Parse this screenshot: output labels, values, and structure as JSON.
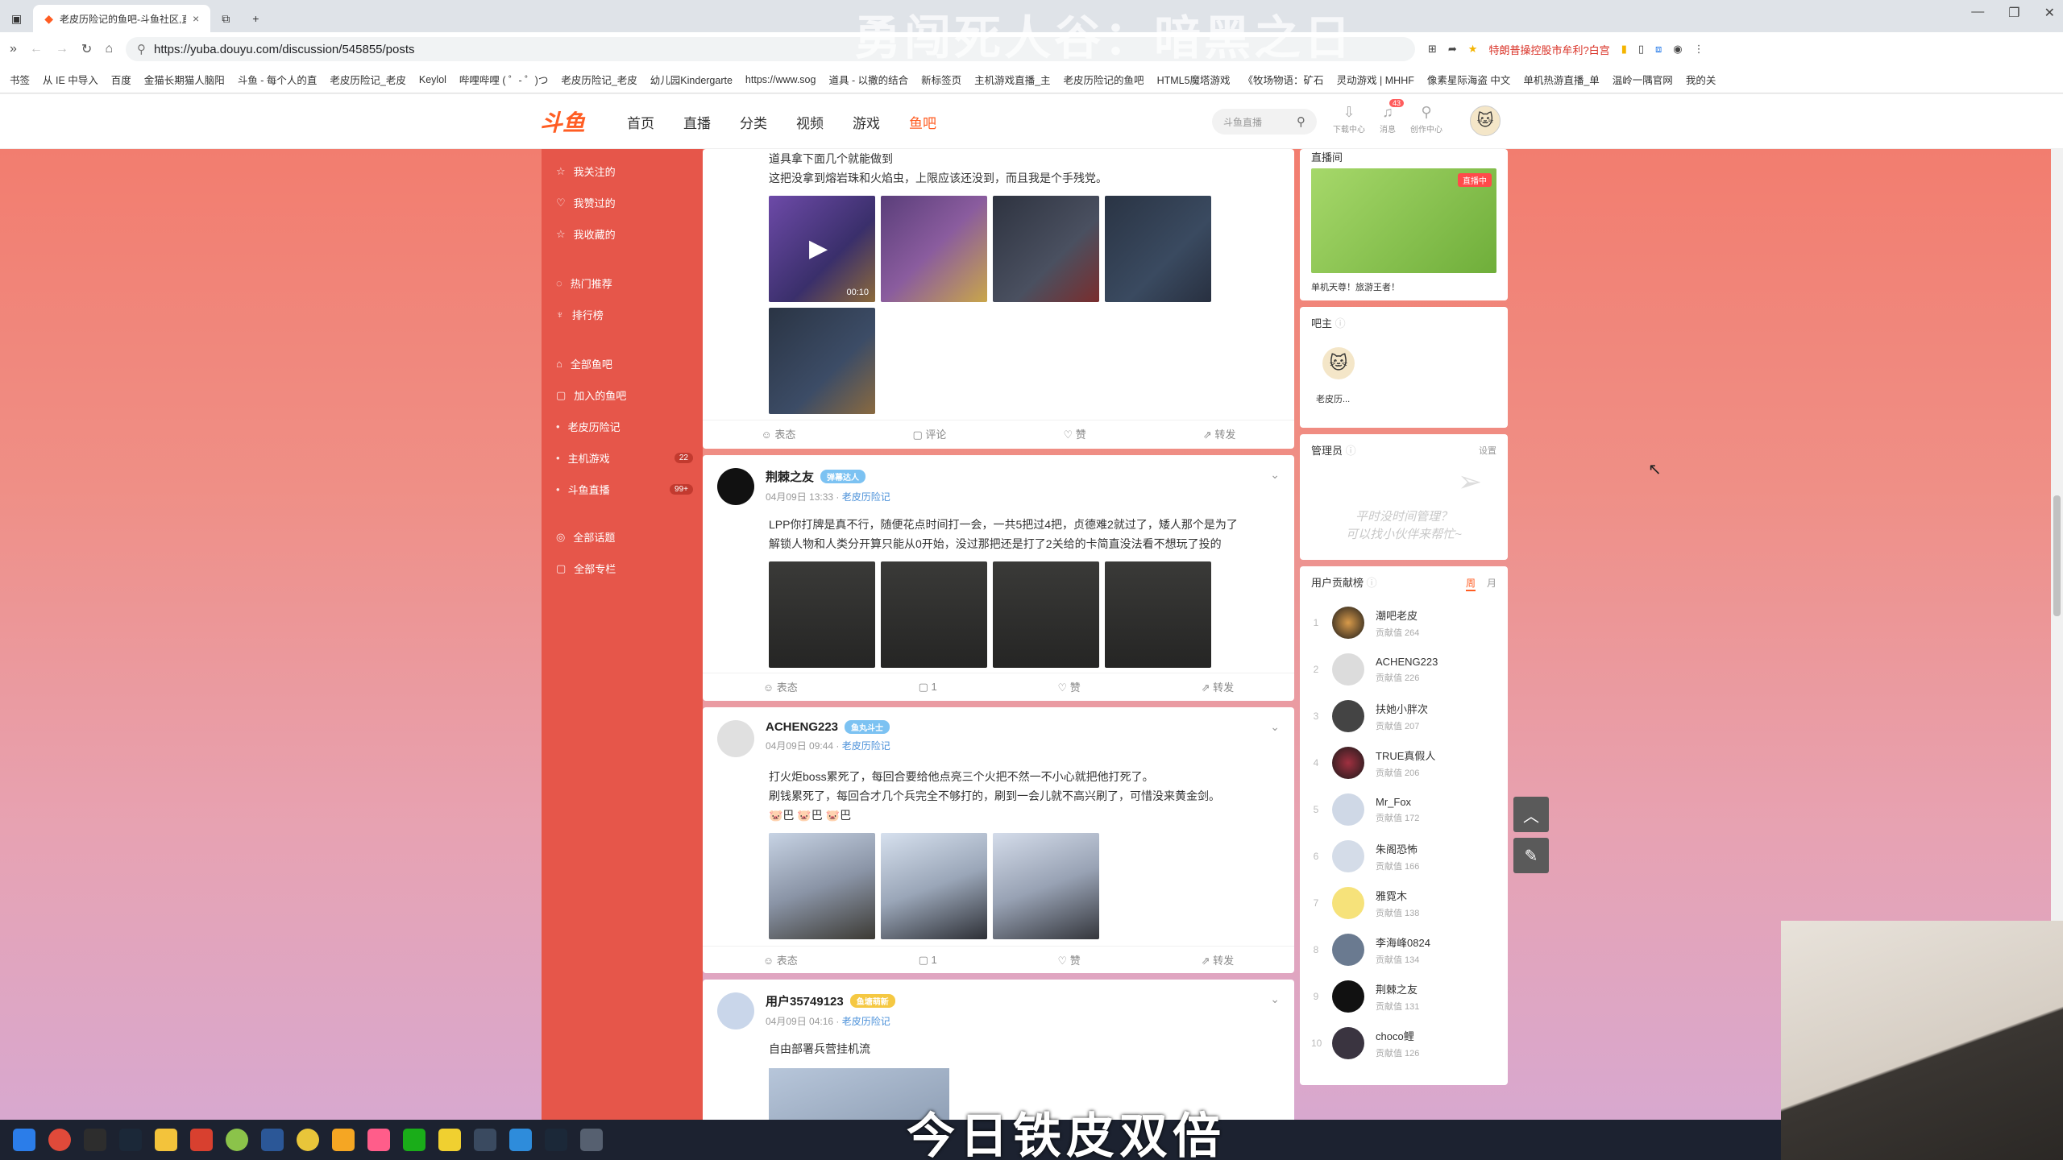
{
  "browser": {
    "tab_title": "老皮历险记的鱼吧-斗鱼社区,直到...",
    "tab_close": "×",
    "new_tab": "+",
    "url": "https://yuba.douyu.com/discussion/545855/posts",
    "address_right": "特朗普操控股市牟利?白宫",
    "bookmarks": [
      "书签",
      "从 IE 中导入",
      "百度",
      "金猫长期猫人脑阳",
      "斗鱼 - 每个人的直",
      "老皮历险记_老皮",
      "Keylol",
      "哔哩哔哩 ( ゜- ゜)つ",
      "老皮历险记_老皮",
      "幼儿园Kindergarte",
      "https://www.sog",
      "道具 - 以撒的结合",
      "新标签页",
      "主机游戏直播_主",
      "老皮历险记的鱼吧",
      "HTML5魔塔游戏",
      "《牧场物语：矿石",
      "灵动游戏 | MHHF",
      "像素星际海盗 中文",
      "单机热游直播_单",
      "温岭一隅官网",
      "我的关"
    ]
  },
  "overlay_title": "勇闯死人谷：暗黑之日",
  "site": {
    "logo": "斗鱼",
    "nav": [
      "首页",
      "直播",
      "分类",
      "视频",
      "游戏",
      "鱼吧"
    ],
    "search_placeholder": "斗鱼直播",
    "header_icons": [
      "下载中心",
      "消息",
      "创作中心"
    ],
    "message_count": "43"
  },
  "sidebar": {
    "items": [
      {
        "label": "我关注的",
        "icon": "star-icon"
      },
      {
        "label": "我赞过的",
        "icon": "thumb-icon"
      },
      {
        "label": "我收藏的",
        "icon": "star-icon"
      },
      {
        "label": "热门推荐",
        "icon": "fire-icon"
      },
      {
        "label": "排行榜",
        "icon": "trophy-icon"
      },
      {
        "label": "全部鱼吧",
        "icon": "home-icon"
      },
      {
        "label": "加入的鱼吧",
        "icon": "doc-icon"
      },
      {
        "label": "老皮历险记",
        "icon": "dot-icon",
        "badge": ""
      },
      {
        "label": "主机游戏",
        "icon": "dot-icon",
        "badge": "22"
      },
      {
        "label": "斗鱼直播",
        "icon": "dot-icon",
        "badge": "99+"
      },
      {
        "label": "全部话题",
        "icon": "circle-icon"
      },
      {
        "label": "全部专栏",
        "icon": "doc-icon"
      }
    ]
  },
  "posts": [
    {
      "text": [
        "道具拿下面几个就能做到",
        "这把没拿到熔岩珠和火焰虫，上限应该还没到，而且我是个手残党。"
      ],
      "video_duration": "00:10",
      "actions": [
        "表态",
        "评论",
        "赞",
        "转发"
      ]
    },
    {
      "author": "荆棘之友",
      "badge": "弹幕达人",
      "meta_time": "04月09日 13:33 ·",
      "meta_link": "老皮历险记",
      "text": [
        "LPP你打牌是真不行，随便花点时间打一会，一共5把过4把，贞德难2就过了，矮人那个是为了",
        "解锁人物和人类分开算只能从0开始，没过那把还是打了2关给的卡简直没法看不想玩了投的"
      ],
      "actions": [
        "表态",
        "1",
        "赞",
        "转发"
      ]
    },
    {
      "author": "ACHENG223",
      "badge": "鱼丸斗士",
      "meta_time": "04月09日 09:44 ·",
      "meta_link": "老皮历险记",
      "text": [
        "打火炬boss累死了，每回合要给他点亮三个火把不然一不小心就把他打死了。",
        "刷钱累死了，每回合才几个兵完全不够打的，刷到一会儿就不高兴刷了，可惜没来黄金剑。",
        "🐷巴 🐷巴 🐷巴"
      ],
      "actions": [
        "表态",
        "1",
        "赞",
        "转发"
      ]
    },
    {
      "author": "用户35749123",
      "badge": "鱼塘萌新",
      "meta_time": "04月09日 04:16 ·",
      "meta_link": "老皮历险记",
      "text": [
        "自由部署兵营挂机流"
      ]
    }
  ],
  "right": {
    "live_title": "直播间",
    "live_tag": "直播中",
    "live_caption": "单机天尊！旅游王者！",
    "owner_title": "吧主",
    "owner_name": "老皮历...",
    "admin_title": "管理员",
    "admin_setting": "设置",
    "admin_empty_1": "平时没时间管理？",
    "admin_empty_2": "可以找小伙伴来帮忙~",
    "rank_title": "用户贡献榜",
    "rank_tabs": [
      "周",
      "月"
    ],
    "rank": [
      {
        "n": "1",
        "name": "潮吧老皮",
        "score": "贡献值 264"
      },
      {
        "n": "2",
        "name": "ACHENG223",
        "score": "贡献值 226"
      },
      {
        "n": "3",
        "name": "扶她小胖次",
        "score": "贡献值 207"
      },
      {
        "n": "4",
        "name": "TRUE真假人",
        "score": "贡献值 206"
      },
      {
        "n": "5",
        "name": "Mr_Fox",
        "score": "贡献值 172"
      },
      {
        "n": "6",
        "name": "朱阁恐怖",
        "score": "贡献值 166"
      },
      {
        "n": "7",
        "name": "雅霓木",
        "score": "贡献值 138"
      },
      {
        "n": "8",
        "name": "李海峰0824",
        "score": "贡献值 134"
      },
      {
        "n": "9",
        "name": "荆棘之友",
        "score": "贡献值 131"
      },
      {
        "n": "10",
        "name": "choco鲤",
        "score": "贡献值 126"
      }
    ]
  },
  "subtitle": "今日铁皮双倍"
}
